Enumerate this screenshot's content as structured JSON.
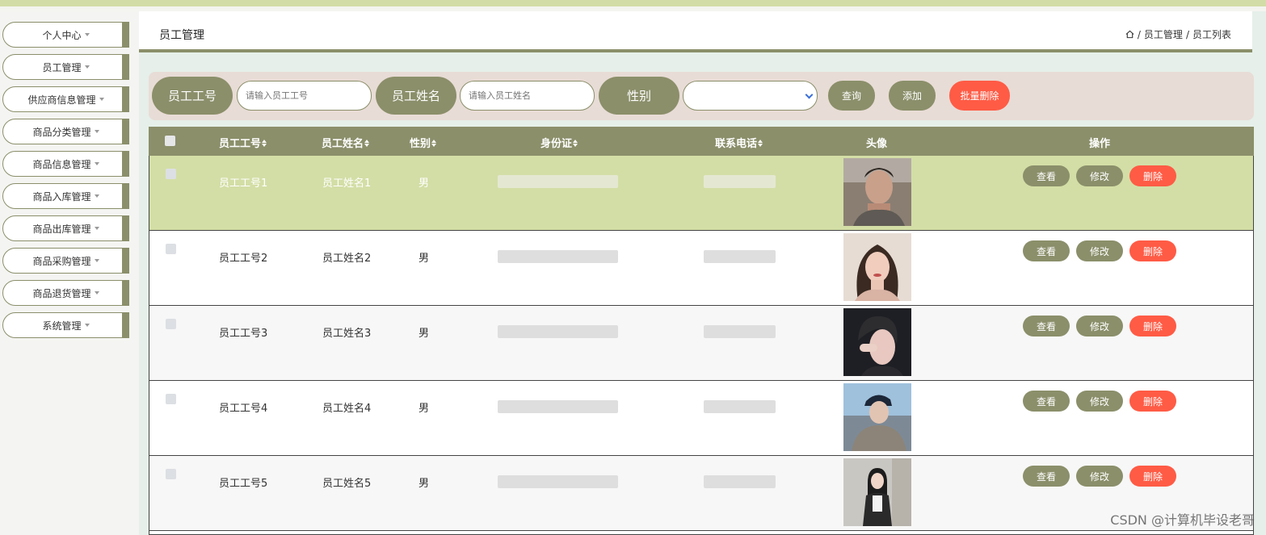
{
  "sidebar": {
    "items": [
      {
        "label": "个人中心"
      },
      {
        "label": "员工管理"
      },
      {
        "label": "供应商信息管理"
      },
      {
        "label": "商品分类管理"
      },
      {
        "label": "商品信息管理"
      },
      {
        "label": "商品入库管理"
      },
      {
        "label": "商品出库管理"
      },
      {
        "label": "商品采购管理"
      },
      {
        "label": "商品退货管理"
      },
      {
        "label": "系统管理"
      }
    ]
  },
  "header": {
    "title": "员工管理",
    "breadcrumb": [
      "员工管理",
      "员工列表"
    ],
    "separator": "/"
  },
  "search": {
    "id_label": "员工工号",
    "id_placeholder": "请输入员工工号",
    "name_label": "员工姓名",
    "name_placeholder": "请输入员工姓名",
    "gender_label": "性别",
    "gender_value": "",
    "query_button": "查询",
    "add_button": "添加",
    "batch_delete_button": "批量删除"
  },
  "table": {
    "headers": {
      "id": "员工工号",
      "name": "员工姓名",
      "gender": "性别",
      "idcard": "身份证",
      "phone": "联系电话",
      "avatar": "头像",
      "actions": "操作"
    },
    "rows": [
      {
        "id": "员工工号1",
        "name": "员工姓名1",
        "gender": "男"
      },
      {
        "id": "员工工号2",
        "name": "员工姓名2",
        "gender": "男"
      },
      {
        "id": "员工工号3",
        "name": "员工姓名3",
        "gender": "男"
      },
      {
        "id": "员工工号4",
        "name": "员工姓名4",
        "gender": "男"
      },
      {
        "id": "员工工号5",
        "name": "员工姓名5",
        "gender": "男"
      }
    ],
    "row_actions": {
      "view": "查看",
      "edit": "修改",
      "delete": "删除"
    }
  },
  "colors": {
    "olive": "#8b8f6a",
    "highlight_row": "#d3dea6",
    "danger": "#ff5b45",
    "search_bg": "#e8dcd6"
  },
  "watermark": "CSDN @计算机毕设老哥"
}
